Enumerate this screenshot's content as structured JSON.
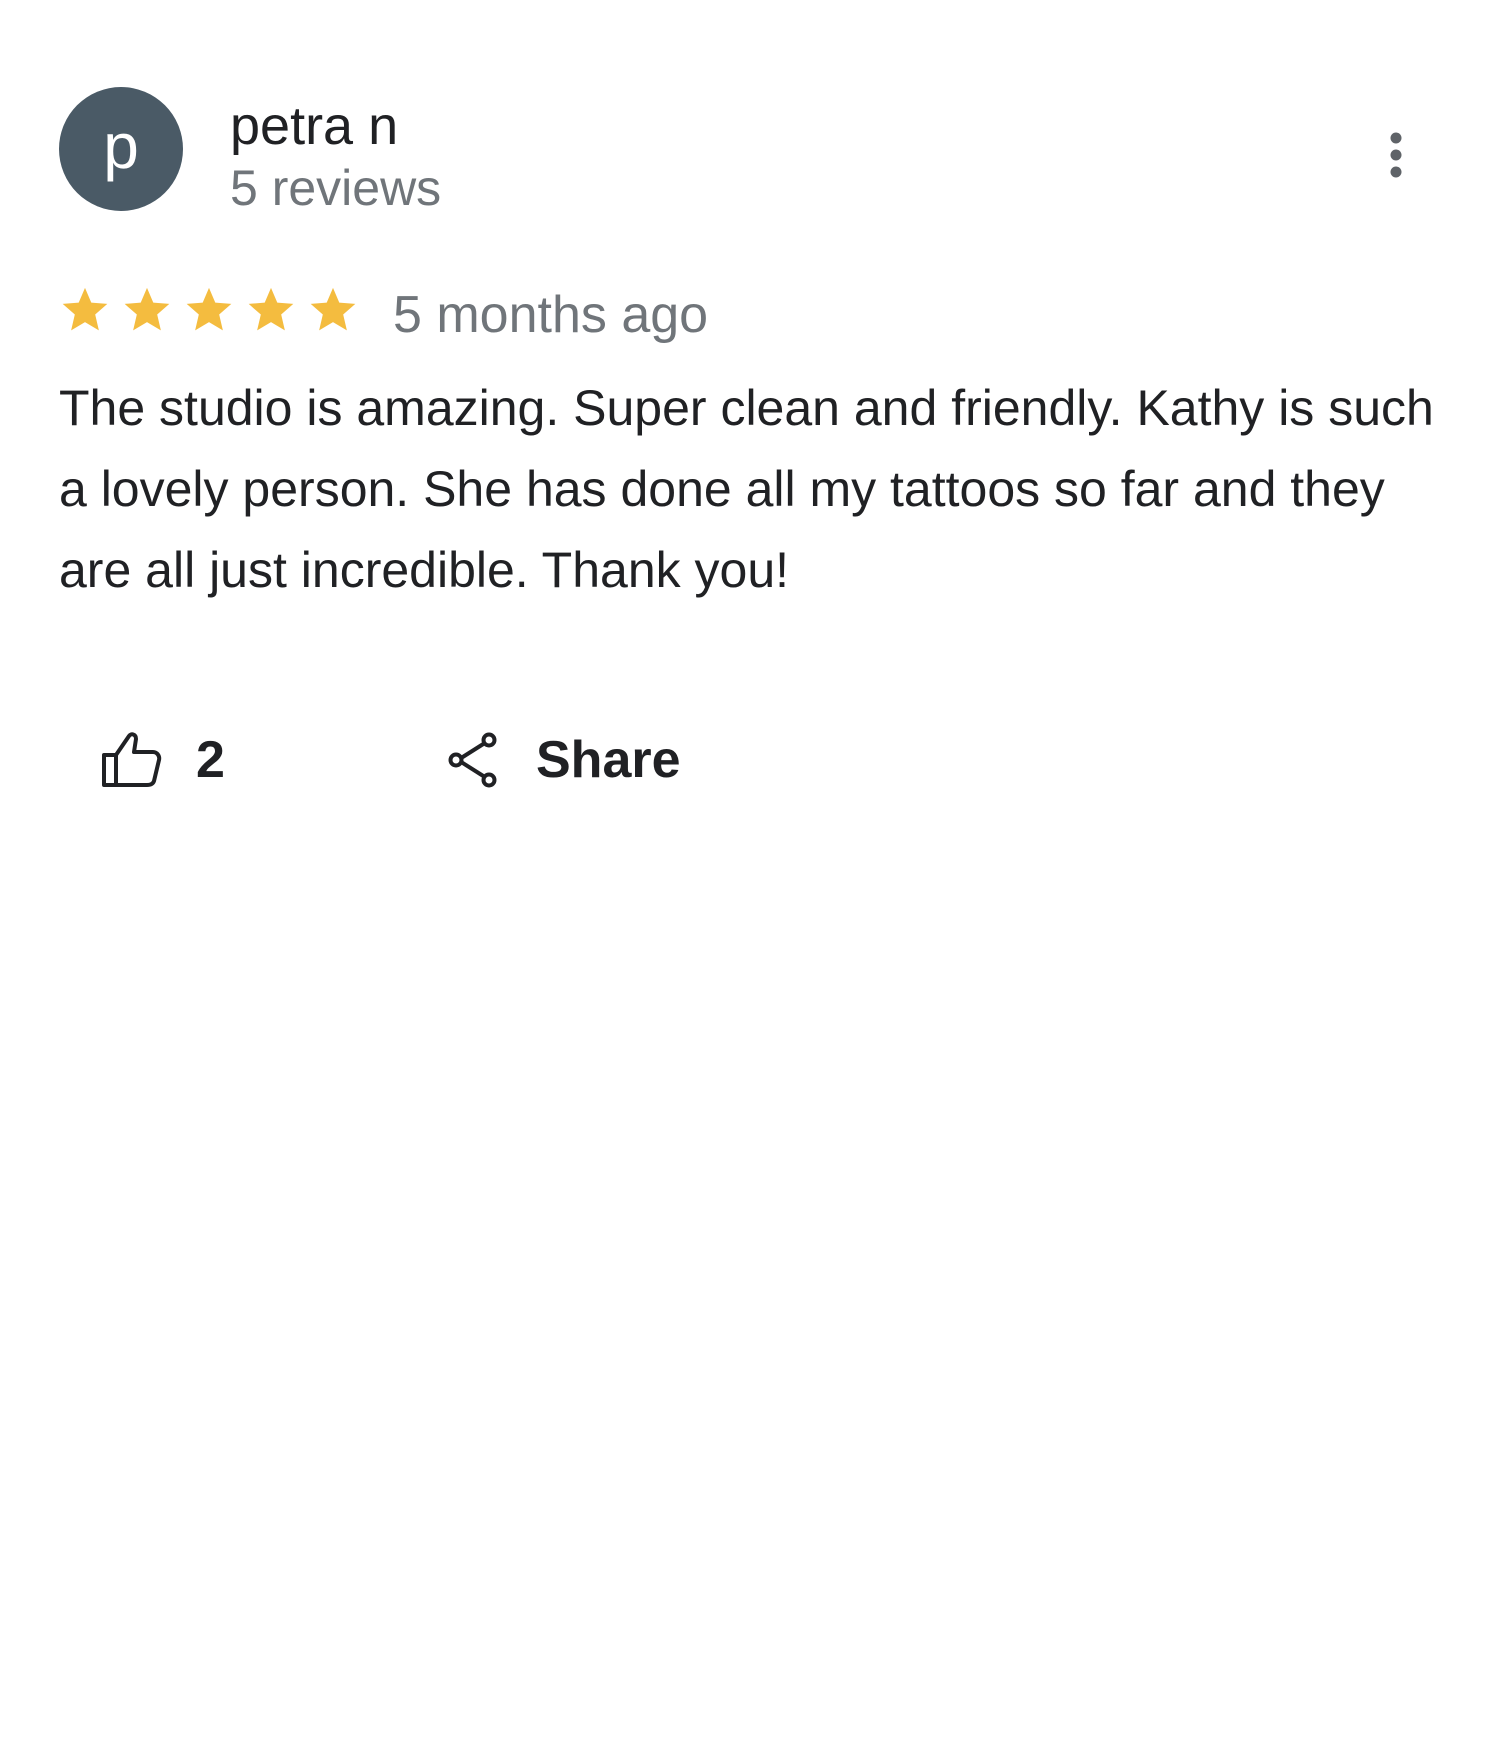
{
  "reviewer": {
    "avatar_letter": "p",
    "avatar_color": "#4a5a66",
    "name": "petra n",
    "review_count": "5 reviews"
  },
  "menu": {
    "icon": "more-vert-icon"
  },
  "review": {
    "rating": 5,
    "max_rating": 5,
    "star_color": "#f4bc3f",
    "date": "5 months ago",
    "text": "The studio is amazing. Super clean and friendly. Kathy is such a lovely person. She has done all my tattoos so far and they are all just incredible. Thank you!"
  },
  "actions": {
    "like_icon": "thumbs-up-icon",
    "like_count": "2",
    "share_icon": "share-icon",
    "share_label": "Share"
  }
}
